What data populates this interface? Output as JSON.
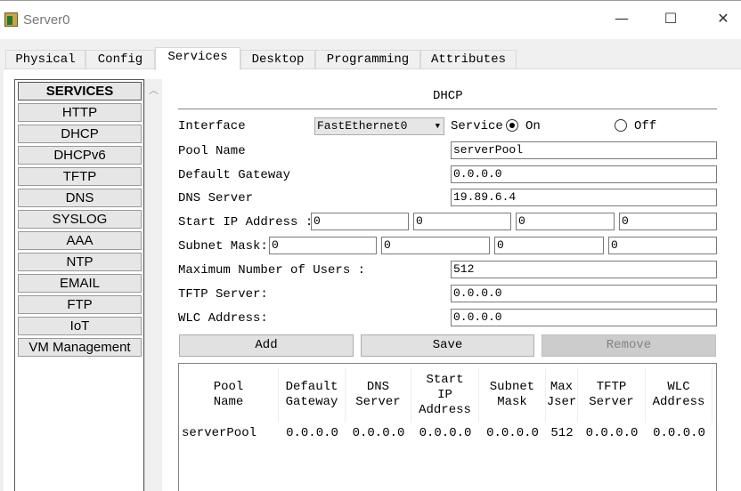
{
  "window": {
    "title": "Server0",
    "minimize": "—",
    "maximize": "☐",
    "close": "✕"
  },
  "tabs": [
    "Physical",
    "Config",
    "Services",
    "Desktop",
    "Programming",
    "Attributes"
  ],
  "active_tab": "Services",
  "sidebar": {
    "header": "SERVICES",
    "items": [
      "HTTP",
      "DHCP",
      "DHCPv6",
      "TFTP",
      "DNS",
      "SYSLOG",
      "AAA",
      "NTP",
      "EMAIL",
      "FTP",
      "IoT",
      "VM Management"
    ]
  },
  "dhcp": {
    "title": "DHCP",
    "interface_label": "Interface",
    "interface_value": "FastEthernet0",
    "service_label": "Service",
    "on_label": "On",
    "off_label": "Off",
    "service_on": true,
    "pool_name_label": "Pool Name",
    "pool_name": "serverPool",
    "gateway_label": "Default Gateway",
    "gateway": "0.0.0.0",
    "dns_label": "DNS Server",
    "dns": "19.89.6.4",
    "start_ip_label": "Start IP Address :",
    "start_ip": [
      "0",
      "0",
      "0",
      "0"
    ],
    "subnet_label": "Subnet Mask:",
    "subnet": [
      "0",
      "0",
      "0",
      "0"
    ],
    "max_users_label": "Maximum Number of Users :",
    "max_users": "512",
    "tftp_label": "TFTP Server:",
    "tftp": "0.0.0.0",
    "wlc_label": "WLC Address:",
    "wlc": "0.0.0.0",
    "add": "Add",
    "save": "Save",
    "remove": "Remove",
    "table": {
      "headers": [
        "Pool\nName",
        "Default\nGateway",
        "DNS\nServer",
        "Start\nIP\nAddress",
        "Subnet\nMask",
        "Max\nJser",
        "TFTP\nServer",
        "WLC\nAddress"
      ],
      "rows": [
        [
          "serverPool",
          "0.0.0.0",
          "0.0.0.0",
          "0.0.0.0",
          "0.0.0.0",
          "512",
          "0.0.0.0",
          "0.0.0.0"
        ]
      ]
    }
  }
}
